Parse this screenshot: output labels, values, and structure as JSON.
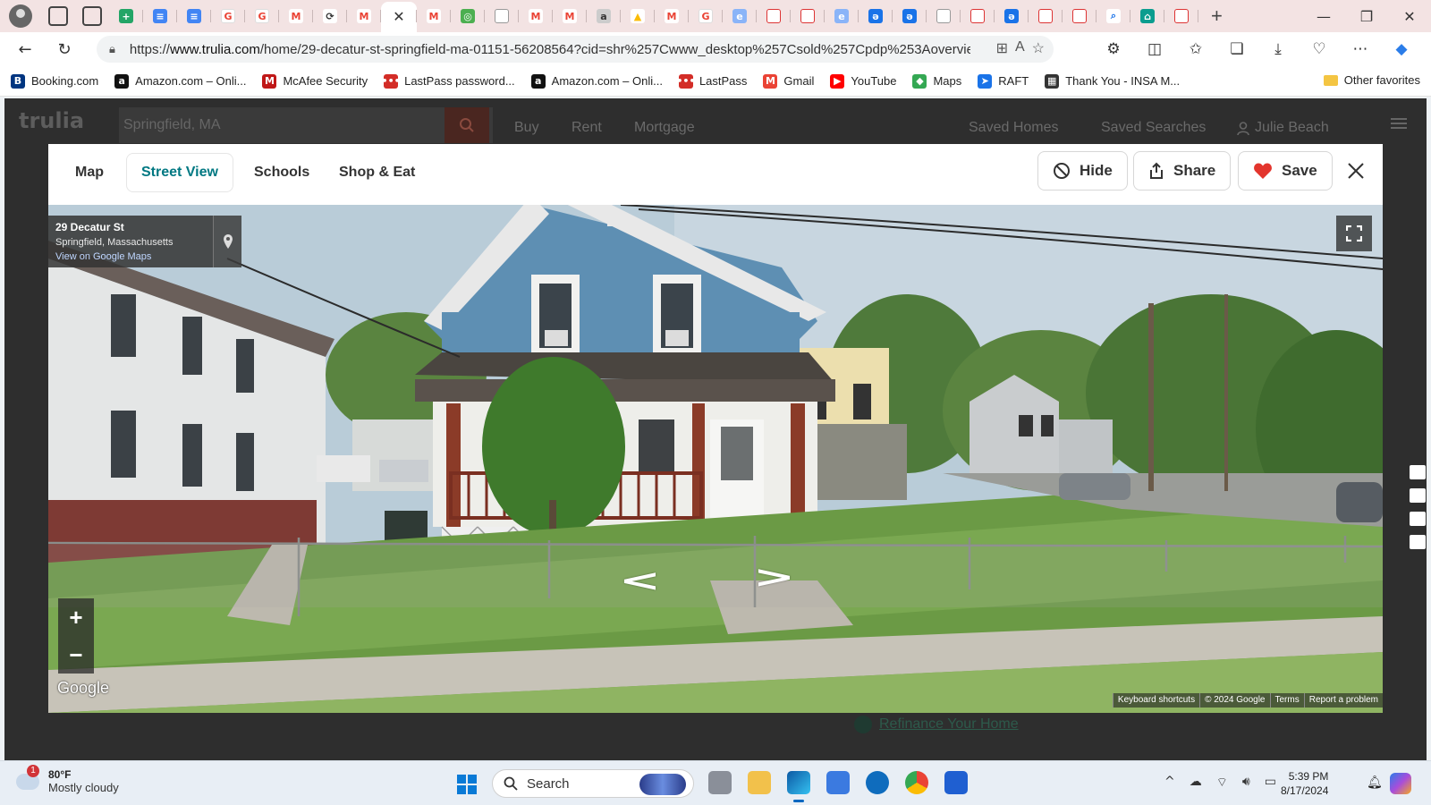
{
  "browser": {
    "url_prefix": "https://",
    "url_domain": "www.trulia.com",
    "url_rest": "/home/29-decatur-st-springfield-ma-01151-56208564?cid=shr%257Cwww_desktop%257Csold%257Cpdp%253Aoverview...",
    "bookmarks": [
      {
        "label": "Booking.com",
        "icon": "B",
        "color": "#003580"
      },
      {
        "label": "Amazon.com – Onli...",
        "icon": "a",
        "color": "#111111"
      },
      {
        "label": "McAfee Security",
        "icon": "M",
        "color": "#c01818"
      },
      {
        "label": "LastPass password...",
        "icon": "•••",
        "color": "#d32d27"
      },
      {
        "label": "Amazon.com – Onli...",
        "icon": "a",
        "color": "#111111"
      },
      {
        "label": "LastPass",
        "icon": "•••",
        "color": "#d32d27"
      },
      {
        "label": "Gmail",
        "icon": "M",
        "color": "#ea4335"
      },
      {
        "label": "YouTube",
        "icon": "▶",
        "color": "#ff0000"
      },
      {
        "label": "Maps",
        "icon": "◆",
        "color": "#34a853"
      },
      {
        "label": "RAFT",
        "icon": "➤",
        "color": "#1a73e8"
      },
      {
        "label": "Thank You - INSA M...",
        "icon": "▦",
        "color": "#333333"
      }
    ],
    "other_favorites": "Other favorites"
  },
  "trulia": {
    "logo": "trulia",
    "search_value": "Springfield, MA",
    "nav": {
      "buy": "Buy",
      "rent": "Rent",
      "mortgage": "Mortgage"
    },
    "saved_homes": "Saved Homes",
    "saved_searches": "Saved Searches",
    "user_name": "Julie Beach",
    "refinance_link": "Refinance Your Home"
  },
  "modal": {
    "tabs": {
      "map": "Map",
      "street_view": "Street View",
      "schools": "Schools",
      "shop_eat": "Shop & Eat"
    },
    "active_tab": "Street View",
    "actions": {
      "hide": "Hide",
      "share": "Share",
      "save": "Save"
    }
  },
  "streetview": {
    "address_line1": "29 Decatur St",
    "address_line2": "Springfield, Massachusetts",
    "view_on_maps": "View on Google Maps",
    "google_logo": "Google",
    "attribution": {
      "keyboard": "Keyboard shortcuts",
      "copyright": "© 2024 Google",
      "terms": "Terms",
      "report": "Report a problem"
    }
  },
  "taskbar": {
    "weather_temp": "80°F",
    "weather_desc": "Mostly cloudy",
    "weather_badge": "1",
    "search_label": "Search",
    "time": "5:39 PM",
    "date": "8/17/2024"
  },
  "colors": {
    "trulia_teal": "#007882",
    "save_heart": "#e3352d",
    "taskbar_bg": "#e8eef5"
  }
}
